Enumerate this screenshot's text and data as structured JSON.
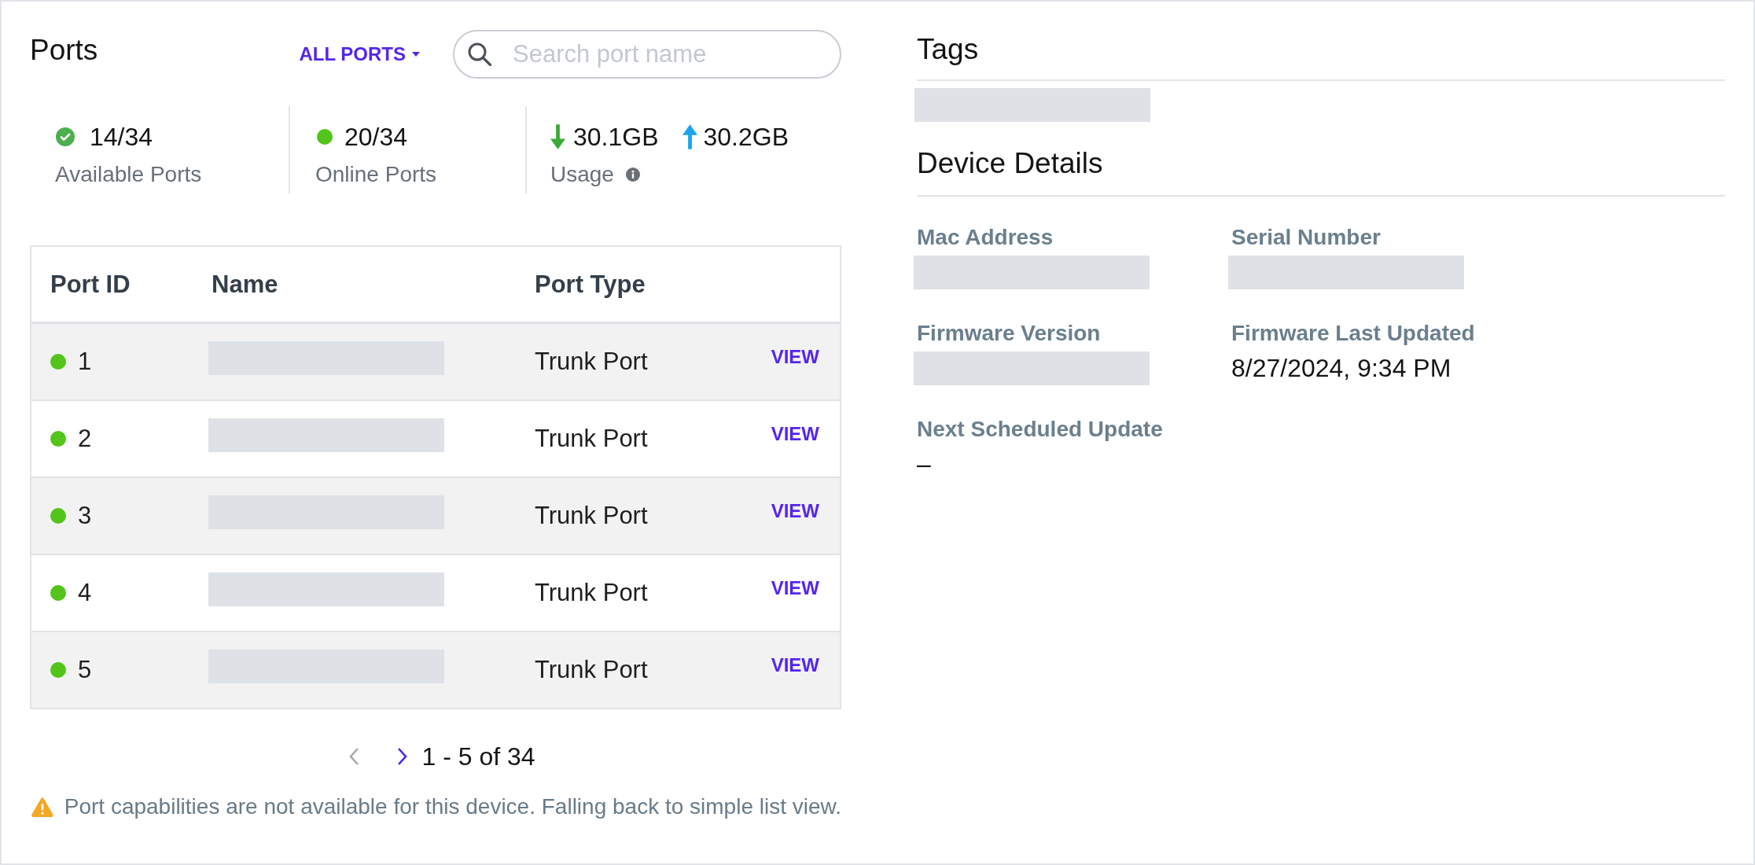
{
  "ports": {
    "title": "Ports",
    "filter": {
      "label": "ALL PORTS"
    },
    "search": {
      "placeholder": "Search port name"
    },
    "stats": [
      {
        "kind": "available",
        "value": "14/34",
        "label": "Available Ports"
      },
      {
        "kind": "online",
        "value": "20/34",
        "label": "Online Ports"
      },
      {
        "kind": "usage",
        "download": "30.1GB",
        "upload": "30.2GB",
        "label": "Usage"
      }
    ],
    "table": {
      "columns": [
        "Port ID",
        "Name",
        "Port Type"
      ],
      "rows": [
        {
          "port_id": "1",
          "online": true,
          "name_redacted": true,
          "port_type": "Trunk Port",
          "action": "VIEW"
        },
        {
          "port_id": "2",
          "online": true,
          "name_redacted": true,
          "port_type": "Trunk Port",
          "action": "VIEW"
        },
        {
          "port_id": "3",
          "online": true,
          "name_redacted": true,
          "port_type": "Trunk Port",
          "action": "VIEW"
        },
        {
          "port_id": "4",
          "online": true,
          "name_redacted": true,
          "port_type": "Trunk Port",
          "action": "VIEW"
        },
        {
          "port_id": "5",
          "online": true,
          "name_redacted": true,
          "port_type": "Trunk Port",
          "action": "VIEW"
        }
      ]
    },
    "pagination": {
      "prev_disabled": true,
      "next_disabled": false,
      "range": "1 - 5 of 34"
    },
    "warning": "Port capabilities are not available for this device. Falling back to simple list view."
  },
  "tags": {
    "title": "Tags",
    "redacted": true
  },
  "device_details": {
    "title": "Device Details",
    "fields": [
      {
        "label": "Mac Address",
        "redacted": true
      },
      {
        "label": "Serial Number",
        "redacted": true
      },
      {
        "label": "Firmware Version",
        "redacted": true
      },
      {
        "label": "Firmware Last Updated",
        "redacted": false,
        "value": "8/27/2024, 9:34 PM"
      },
      {
        "label": "Next Scheduled Update",
        "redacted": false,
        "value": "–"
      }
    ]
  }
}
